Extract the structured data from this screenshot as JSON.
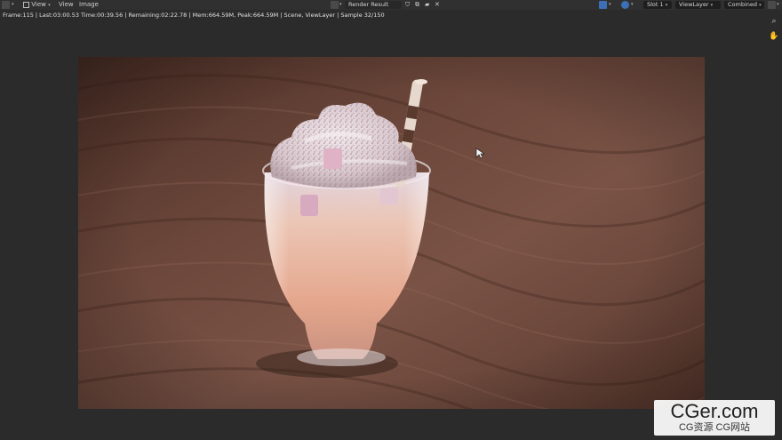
{
  "header": {
    "menu_view_dropdown": "View",
    "menu_view": "View",
    "menu_image": "Image",
    "image_name": "Render Result",
    "slot": "Slot 1",
    "view_layer": "ViewLayer",
    "pass": "Combined"
  },
  "status": {
    "text": "Frame:115 | Last:03:00.53 Time:00:39.56 | Remaining:02:22.78 | Mem:664.59M, Peak:664.59M | Scene, ViewLayer | Sample 32/150"
  },
  "tools": [
    "zoom-icon",
    "hand-pan-icon"
  ],
  "watermark": {
    "main": "CGer.com",
    "sub": "CG资源 CG网站"
  },
  "colors": {
    "header_bg": "#303030",
    "editor_bg": "#2b2b2b",
    "wood_dark": "#4a2e24",
    "wood_light": "#7a5346"
  }
}
